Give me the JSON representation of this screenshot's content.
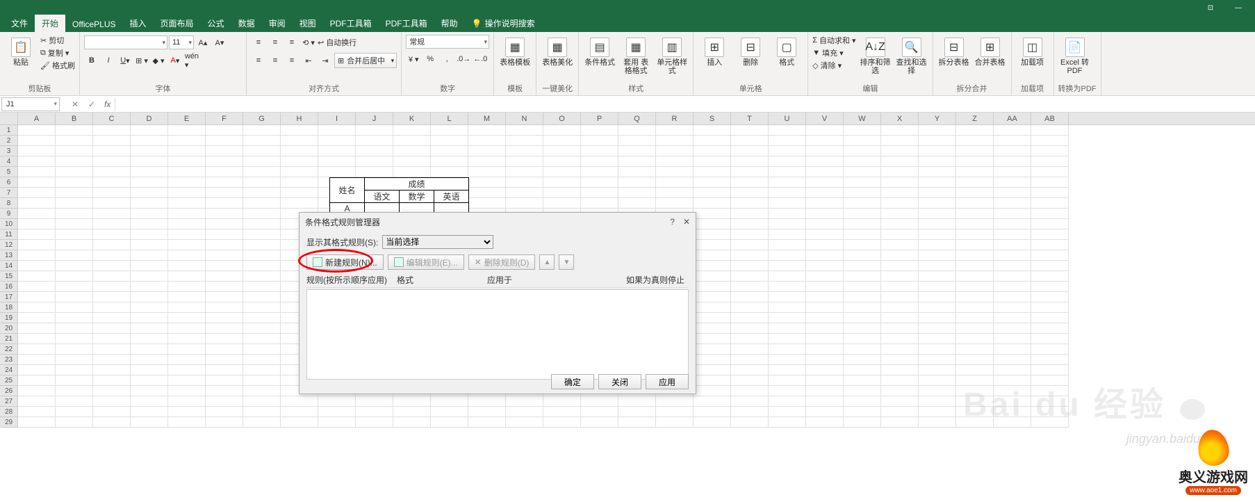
{
  "menu": {
    "tabs": [
      "文件",
      "开始",
      "OfficePLUS",
      "插入",
      "页面布局",
      "公式",
      "数据",
      "审阅",
      "视图",
      "PDF工具箱",
      "PDF工具箱",
      "帮助"
    ],
    "active_index": 1,
    "tell_me": "操作说明搜索"
  },
  "ribbon": {
    "clipboard": {
      "paste": "粘贴",
      "cut": "剪切",
      "copy": "复制",
      "fmt": "格式刷",
      "label": "剪贴板"
    },
    "font": {
      "name": "",
      "size": "11",
      "label": "字体"
    },
    "align": {
      "wrap": "自动换行",
      "merge": "合并后居中",
      "label": "对齐方式"
    },
    "number": {
      "fmt": "常规",
      "label": "数字"
    },
    "template": {
      "btn": "表格模板",
      "label": "模板"
    },
    "beautify": {
      "btn": "表格美化",
      "label": "一键美化"
    },
    "styles": {
      "cond": "条件格式",
      "table": "套用\n表格格式",
      "cell": "单元格样式",
      "label": "样式"
    },
    "cells": {
      "ins": "插入",
      "del": "删除",
      "fmt": "格式",
      "label": "单元格"
    },
    "editing": {
      "sum": "自动求和",
      "fill": "填充",
      "clear": "清除",
      "sort": "排序和筛选",
      "find": "查找和选择",
      "label": "编辑"
    },
    "split": {
      "a": "拆分表格",
      "b": "合并表格",
      "label": "拆分合并"
    },
    "addin": {
      "btn": "加载项",
      "label": "加载项"
    },
    "pdf": {
      "btn": "Excel\n转PDF",
      "label": "转换为PDF"
    }
  },
  "fbar": {
    "name": "J1"
  },
  "columns": [
    "A",
    "B",
    "C",
    "D",
    "E",
    "F",
    "G",
    "H",
    "I",
    "J",
    "K",
    "L",
    "M",
    "N",
    "O",
    "P",
    "Q",
    "R",
    "S",
    "T",
    "U",
    "V",
    "W",
    "X",
    "Y",
    "Z",
    "AA",
    "AB"
  ],
  "rowcount": 29,
  "sheet": {
    "h1": "姓名",
    "h2": "成绩",
    "sub": [
      "语文",
      "数学",
      "英语"
    ],
    "rows": [
      "A"
    ]
  },
  "dialog": {
    "title": "条件格式规则管理器",
    "show_label": "显示其格式规则(S):",
    "show_value": "当前选择",
    "new_rule": "新建规则(N)...",
    "edit_rule": "编辑规则(E)...",
    "del_rule": "删除规则(D)",
    "cols": [
      "规则(按所示顺序应用)",
      "格式",
      "应用于",
      "如果为真则停止"
    ],
    "ok": "确定",
    "close": "关闭",
    "apply": "应用"
  },
  "watermark": {
    "brand": "Bai du 经验",
    "sub": "jingyan.baidu.com",
    "logo": "奥义游戏网",
    "logo_url": "www.aoe1.com"
  }
}
